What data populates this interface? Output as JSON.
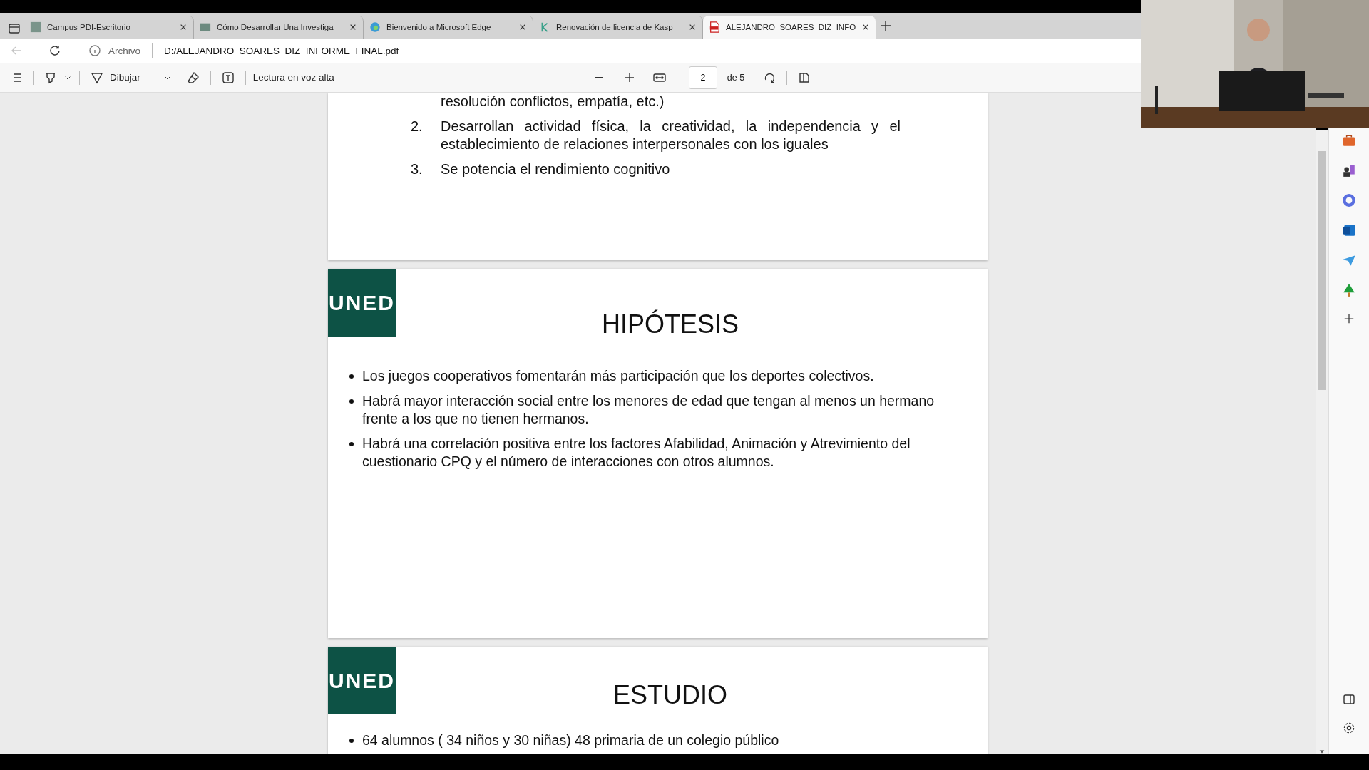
{
  "tabs": [
    {
      "title": "Campus PDI-Escritorio",
      "kind": "square",
      "selected": false
    },
    {
      "title": "Cómo Desarrollar Una Investiga",
      "kind": "banner",
      "selected": false
    },
    {
      "title": "Bienvenido a Microsoft Edge",
      "kind": "swirl",
      "selected": false
    },
    {
      "title": "Renovación de licencia de Kasp",
      "kind": "mark",
      "selected": false
    },
    {
      "title": "ALEJANDRO_SOARES_DIZ_INFO",
      "kind": "pdf",
      "selected": true
    }
  ],
  "address": {
    "back_disabled": true,
    "scheme_label": "Archivo",
    "url": "D:/ALEJANDRO_SOARES_DIZ_INFORME_FINAL.pdf"
  },
  "toolbar": {
    "draw_label": "Dibujar",
    "read_aloud": "Lectura en voz alta",
    "page": "2",
    "page_count": "de 5"
  },
  "pages": [
    {
      "kind": "list",
      "items": [
        {
          "text": "resolución conflictos, empatía, etc.)"
        },
        {
          "number": "2.",
          "text": "Desarrollan actividad física, la creatividad, la independencia y el establecimiento de relaciones interpersonales con los iguales"
        },
        {
          "number": "3.",
          "text": "Se potencia el rendimiento cognitivo"
        }
      ]
    },
    {
      "kind": "slide",
      "logo": "UNED",
      "title": "HIPÓTESIS",
      "bullets": [
        "Los juegos cooperativos fomentarán más participación que los deportes colectivos.",
        "Habrá mayor interacción social entre los menores de edad que tengan al menos un hermano frente a los que no tienen hermanos.",
        "Habrá una correlación positiva entre los factores Afabilidad, Animación y Atrevimiento del cuestionario CPQ y el número de interacciones con otros alumnos."
      ]
    },
    {
      "kind": "slide",
      "logo": "UNED",
      "title": "ESTUDIO",
      "bullets": [
        "64 alumnos ( 34 niños y 30 niñas) 48 primaria de un colegio público"
      ]
    }
  ]
}
